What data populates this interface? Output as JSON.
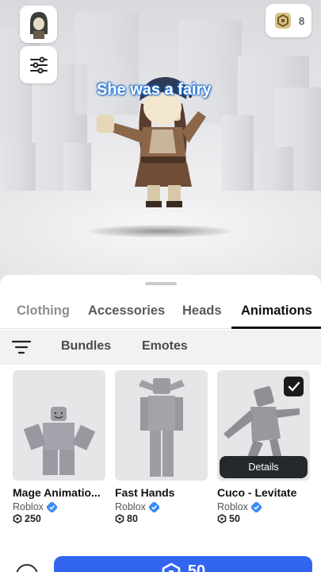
{
  "topbar": {
    "avatar_icon": "avatar-thumbnail-icon",
    "filter_icon": "sliders-icon",
    "robux_icon": "robux-icon",
    "robux_balance": "8"
  },
  "scene": {
    "speech_bubble": "She was a fairy"
  },
  "tabs": [
    {
      "label": "Clothing"
    },
    {
      "label": "Accessories"
    },
    {
      "label": "Heads"
    },
    {
      "label": "Animations"
    }
  ],
  "subtabs": {
    "sort_icon": "sort-filter-icon",
    "items": [
      {
        "label": "Bundles"
      },
      {
        "label": "Emotes"
      }
    ]
  },
  "items": [
    {
      "title": "Mage Animatio...",
      "creator": "Roblox",
      "price": "250",
      "verified": true,
      "selected": false
    },
    {
      "title": "Fast Hands",
      "creator": "Roblox",
      "price": "80",
      "verified": true,
      "selected": false
    },
    {
      "title": "Cuco - Levitate",
      "creator": "Roblox",
      "price": "50",
      "verified": true,
      "selected": true,
      "details_label": "Details"
    }
  ],
  "buy_button": {
    "price": "50",
    "icon": "robux-icon"
  },
  "colors": {
    "accent_blue": "#3366f0",
    "verified_blue": "#3a8bf5",
    "active_tab": "#111111"
  }
}
